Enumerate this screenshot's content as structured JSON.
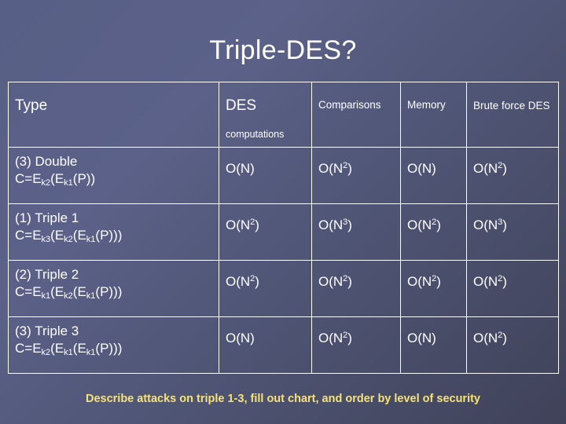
{
  "slide": {
    "title": "Triple-DES?",
    "footer_note": "Describe attacks on triple 1-3, fill out chart, and order by level of security",
    "accent_color": "#f7e27a",
    "background_colors": [
      "#585f86",
      "#3f4259"
    ]
  },
  "table": {
    "headers": {
      "type": "Type",
      "des_main": "DES",
      "des_sub": "computations",
      "comparisons": "Comparisons",
      "memory": "Memory",
      "brute_force": "Brute force DES"
    },
    "rows": [
      {
        "label_line1": "(3) Double",
        "label_line2": "C=Ek2(Ek1(P))",
        "des": "O(N)",
        "comparisons": "O(N2)",
        "memory": "O(N)",
        "brute": "O(N2)"
      },
      {
        "label_line1": "(1) Triple 1",
        "label_line2": "C=Ek3(Ek2(Ek1(P)))",
        "des": "O(N2)",
        "comparisons": "O(N3)",
        "memory": "O(N2)",
        "brute": "O(N3)"
      },
      {
        "label_line1": "(2) Triple 2",
        "label_line2": "C=Ek1(Ek2(Ek1(P)))",
        "des": "O(N2)",
        "comparisons": "O(N2)",
        "memory": "O(N2)",
        "brute": "O(N2)"
      },
      {
        "label_line1": "(3) Triple 3",
        "label_line2": "C=Ek2(Ek1(Ek1(P)))",
        "des": "O(N)",
        "comparisons": "O(N2)",
        "memory": "O(N)",
        "brute": "O(N2)"
      }
    ]
  }
}
